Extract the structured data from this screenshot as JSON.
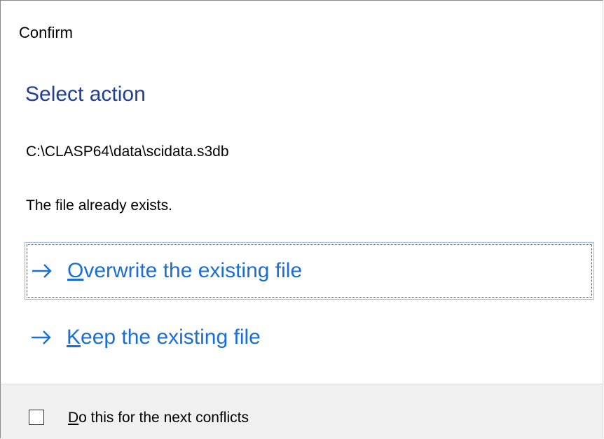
{
  "window": {
    "title": "Confirm"
  },
  "main": {
    "heading": "Select action",
    "file_path": "C:\\CLASP64\\data\\scidata.s3db",
    "message": "The file already exists."
  },
  "actions": [
    {
      "accel": "O",
      "rest": "verwrite the existing file",
      "icon": "arrow-right-icon",
      "focused": true
    },
    {
      "accel": "K",
      "rest": "eep the existing file",
      "icon": "arrow-right-icon",
      "focused": false
    }
  ],
  "footer": {
    "checkbox_checked": false,
    "checkbox_accel": "D",
    "checkbox_rest": "o this for the next conflicts"
  },
  "colors": {
    "heading": "#1f3f93",
    "link": "#1a6ed8",
    "footer_bg": "#f0f0f0",
    "focus_border": "#9dbce2"
  }
}
